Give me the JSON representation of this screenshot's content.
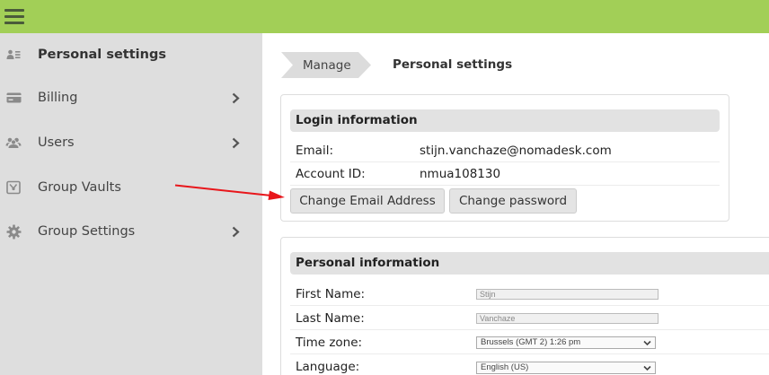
{
  "topbar": {
    "menu_icon": "hamburger-icon",
    "color": "#a2cf57"
  },
  "sidebar": {
    "items": [
      {
        "label": "Personal settings",
        "icon": "contact-card-icon",
        "active": true
      },
      {
        "label": "Billing",
        "icon": "credit-card-icon",
        "has_chevron": true
      },
      {
        "label": "Users",
        "icon": "users-icon",
        "has_chevron": true
      },
      {
        "label": "Group Vaults",
        "icon": "vault-icon"
      },
      {
        "label": "Group Settings",
        "icon": "gear-icon",
        "has_chevron": true
      }
    ]
  },
  "breadcrumb": {
    "parent": "Manage",
    "current": "Personal settings"
  },
  "login": {
    "title": "Login information",
    "email_label": "Email:",
    "email_value": "stijn.vanchaze@nomadesk.com",
    "account_label": "Account ID:",
    "account_value": "nmua108130",
    "change_email_button": "Change Email Address",
    "change_password_button": "Change password"
  },
  "personal": {
    "title": "Personal information",
    "first_name_label": "First Name:",
    "first_name_value": "Stijn",
    "last_name_label": "Last Name:",
    "last_name_value": "Vanchaze",
    "timezone_label": "Time zone:",
    "timezone_value": "Brussels (GMT 2) 1:26 pm",
    "language_label": "Language:",
    "language_value": "English (US)"
  },
  "annotation": {
    "arrow_color": "#e8161b"
  }
}
